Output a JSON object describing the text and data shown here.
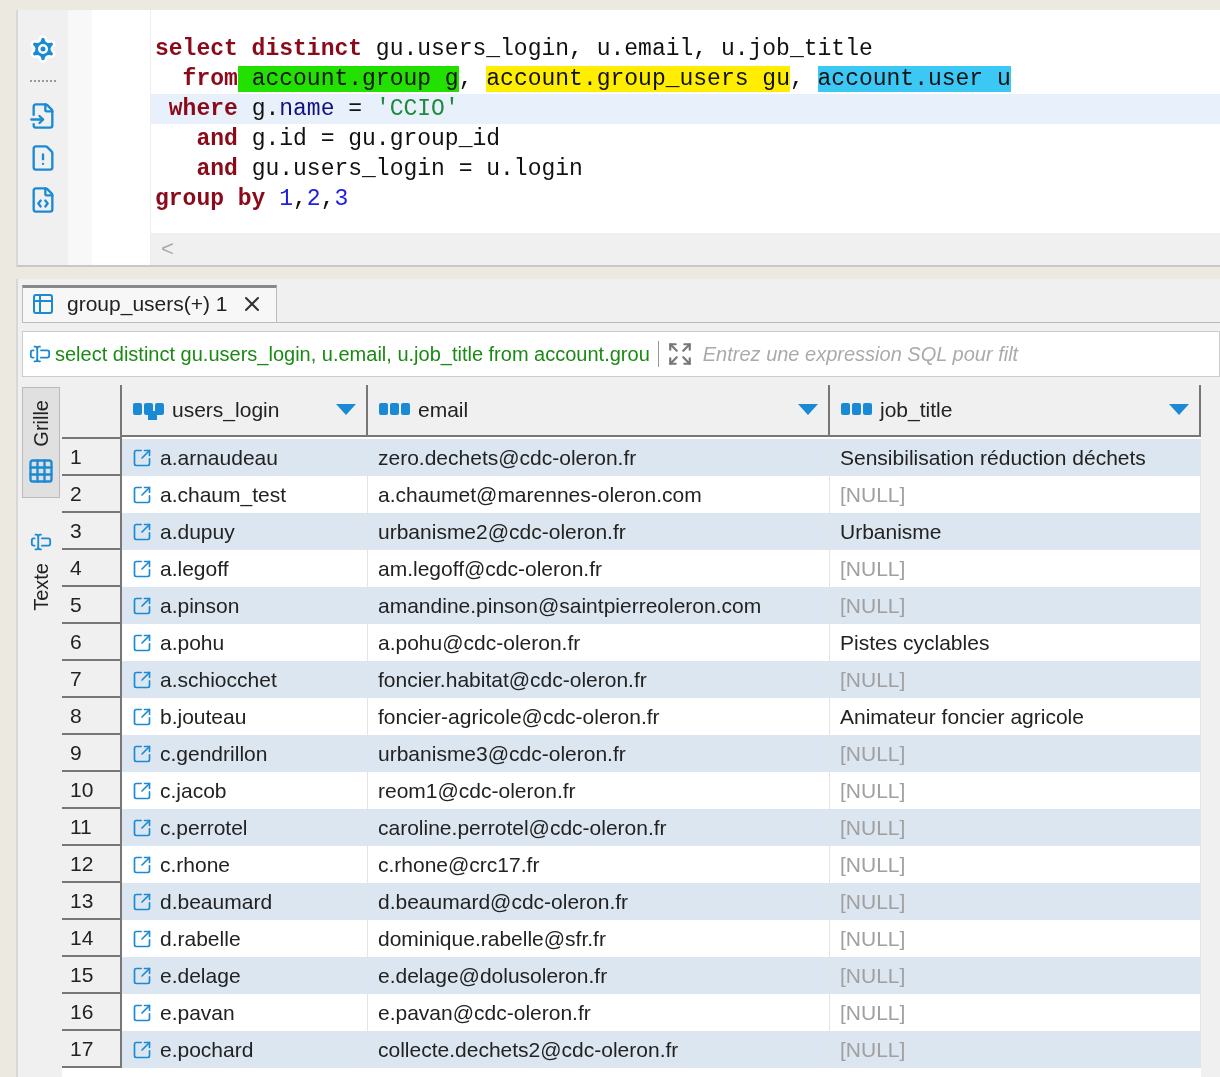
{
  "editor": {
    "lines": [
      {
        "current": false,
        "tokens": [
          {
            "kind": "keyword",
            "text": "select distinct"
          },
          {
            "kind": "plain",
            "text": " gu.users_login, u.email, u.job_title"
          }
        ]
      },
      {
        "current": false,
        "tokens": [
          {
            "kind": "keyword",
            "text": "  from"
          },
          {
            "kind": "plain",
            "text": " account.group g",
            "color": "#22e000"
          },
          {
            "kind": "plain",
            "text": ", "
          },
          {
            "kind": "plain",
            "text": "account.group_users gu",
            "color": "#ffee00"
          },
          {
            "kind": "plain",
            "text": ", "
          },
          {
            "kind": "plain",
            "text": "account.user u",
            "color": "#3cc8f4"
          }
        ]
      },
      {
        "current": true,
        "tokens": [
          {
            "kind": "keyword",
            "text": " where"
          },
          {
            "kind": "plain",
            "text": " g."
          },
          {
            "kind": "field",
            "text": "name"
          },
          {
            "kind": "plain",
            "text": " = "
          },
          {
            "kind": "string",
            "text": "'CCIO'"
          }
        ]
      },
      {
        "current": false,
        "tokens": [
          {
            "kind": "keyword",
            "text": "   and"
          },
          {
            "kind": "plain",
            "text": " g.id = gu.group_id"
          }
        ]
      },
      {
        "current": false,
        "tokens": [
          {
            "kind": "keyword",
            "text": "   and"
          },
          {
            "kind": "plain",
            "text": " gu.users_login = u.login"
          }
        ]
      },
      {
        "current": false,
        "tokens": [
          {
            "kind": "keyword",
            "text": "group by "
          },
          {
            "kind": "number",
            "text": "1"
          },
          {
            "kind": "plain",
            "text": ","
          },
          {
            "kind": "number",
            "text": "2"
          },
          {
            "kind": "plain",
            "text": ","
          },
          {
            "kind": "number",
            "text": "3"
          }
        ]
      }
    ],
    "scroll_left": "<"
  },
  "results": {
    "tab": {
      "label": "group_users(+) 1",
      "selected": true
    },
    "filter": {
      "query": "select distinct gu.users_login, u.email, u.job_title from account.grou",
      "placeholder": "Entrez une expression SQL pour filt"
    },
    "side_tabs": [
      {
        "label": "Grille",
        "selected": true,
        "kind": "grid"
      },
      {
        "label": "Texte",
        "selected": false,
        "kind": "text"
      }
    ],
    "table": {
      "columns": [
        {
          "label": "users_login",
          "kind": "key"
        },
        {
          "label": "email",
          "kind": "text"
        },
        {
          "label": "job_title",
          "kind": "text"
        }
      ],
      "rows": [
        {
          "num": "1",
          "login": "a.arnaudeau",
          "email": "zero.dechets@cdc-oleron.fr",
          "job_title": "Sensibilisation réduction déchets",
          "is_null": false
        },
        {
          "num": "2",
          "login": "a.chaum_test",
          "email": "a.chaumet@marennes-oleron.com",
          "job_title": "[NULL]",
          "is_null": true
        },
        {
          "num": "3",
          "login": "a.dupuy",
          "email": "urbanisme2@cdc-oleron.fr",
          "job_title": "Urbanisme",
          "is_null": false
        },
        {
          "num": "4",
          "login": "a.legoff",
          "email": "am.legoff@cdc-oleron.fr",
          "job_title": "[NULL]",
          "is_null": true
        },
        {
          "num": "5",
          "login": "a.pinson",
          "email": "amandine.pinson@saintpierreoleron.com",
          "job_title": "[NULL]",
          "is_null": true
        },
        {
          "num": "6",
          "login": "a.pohu",
          "email": "a.pohu@cdc-oleron.fr",
          "job_title": "Pistes cyclables",
          "is_null": false
        },
        {
          "num": "7",
          "login": "a.schiocchet",
          "email": "foncier.habitat@cdc-oleron.fr",
          "job_title": "[NULL]",
          "is_null": true
        },
        {
          "num": "8",
          "login": "b.jouteau",
          "email": "foncier-agricole@cdc-oleron.fr",
          "job_title": "Animateur foncier agricole",
          "is_null": false
        },
        {
          "num": "9",
          "login": "c.gendrillon",
          "email": "urbanisme3@cdc-oleron.fr",
          "job_title": "[NULL]",
          "is_null": true
        },
        {
          "num": "10",
          "login": "c.jacob",
          "email": "reom1@cdc-oleron.fr",
          "job_title": "[NULL]",
          "is_null": true
        },
        {
          "num": "11",
          "login": "c.perrotel",
          "email": "caroline.perrotel@cdc-oleron.fr",
          "job_title": "[NULL]",
          "is_null": true
        },
        {
          "num": "12",
          "login": "c.rhone",
          "email": "c.rhone@crc17.fr",
          "job_title": "[NULL]",
          "is_null": true
        },
        {
          "num": "13",
          "login": "d.beaumard",
          "email": "d.beaumard@cdc-oleron.fr",
          "job_title": "[NULL]",
          "is_null": true
        },
        {
          "num": "14",
          "login": "d.rabelle",
          "email": "dominique.rabelle@sfr.fr",
          "job_title": "[NULL]",
          "is_null": true
        },
        {
          "num": "15",
          "login": "e.delage",
          "email": "e.delage@dolusoleron.fr",
          "job_title": "[NULL]",
          "is_null": true
        },
        {
          "num": "16",
          "login": "e.pavan",
          "email": "e.pavan@cdc-oleron.fr",
          "job_title": "[NULL]",
          "is_null": true
        },
        {
          "num": "17",
          "login": "e.pochard",
          "email": "collecte.dechets2@cdc-oleron.fr",
          "job_title": "[NULL]",
          "is_null": true
        }
      ]
    }
  }
}
